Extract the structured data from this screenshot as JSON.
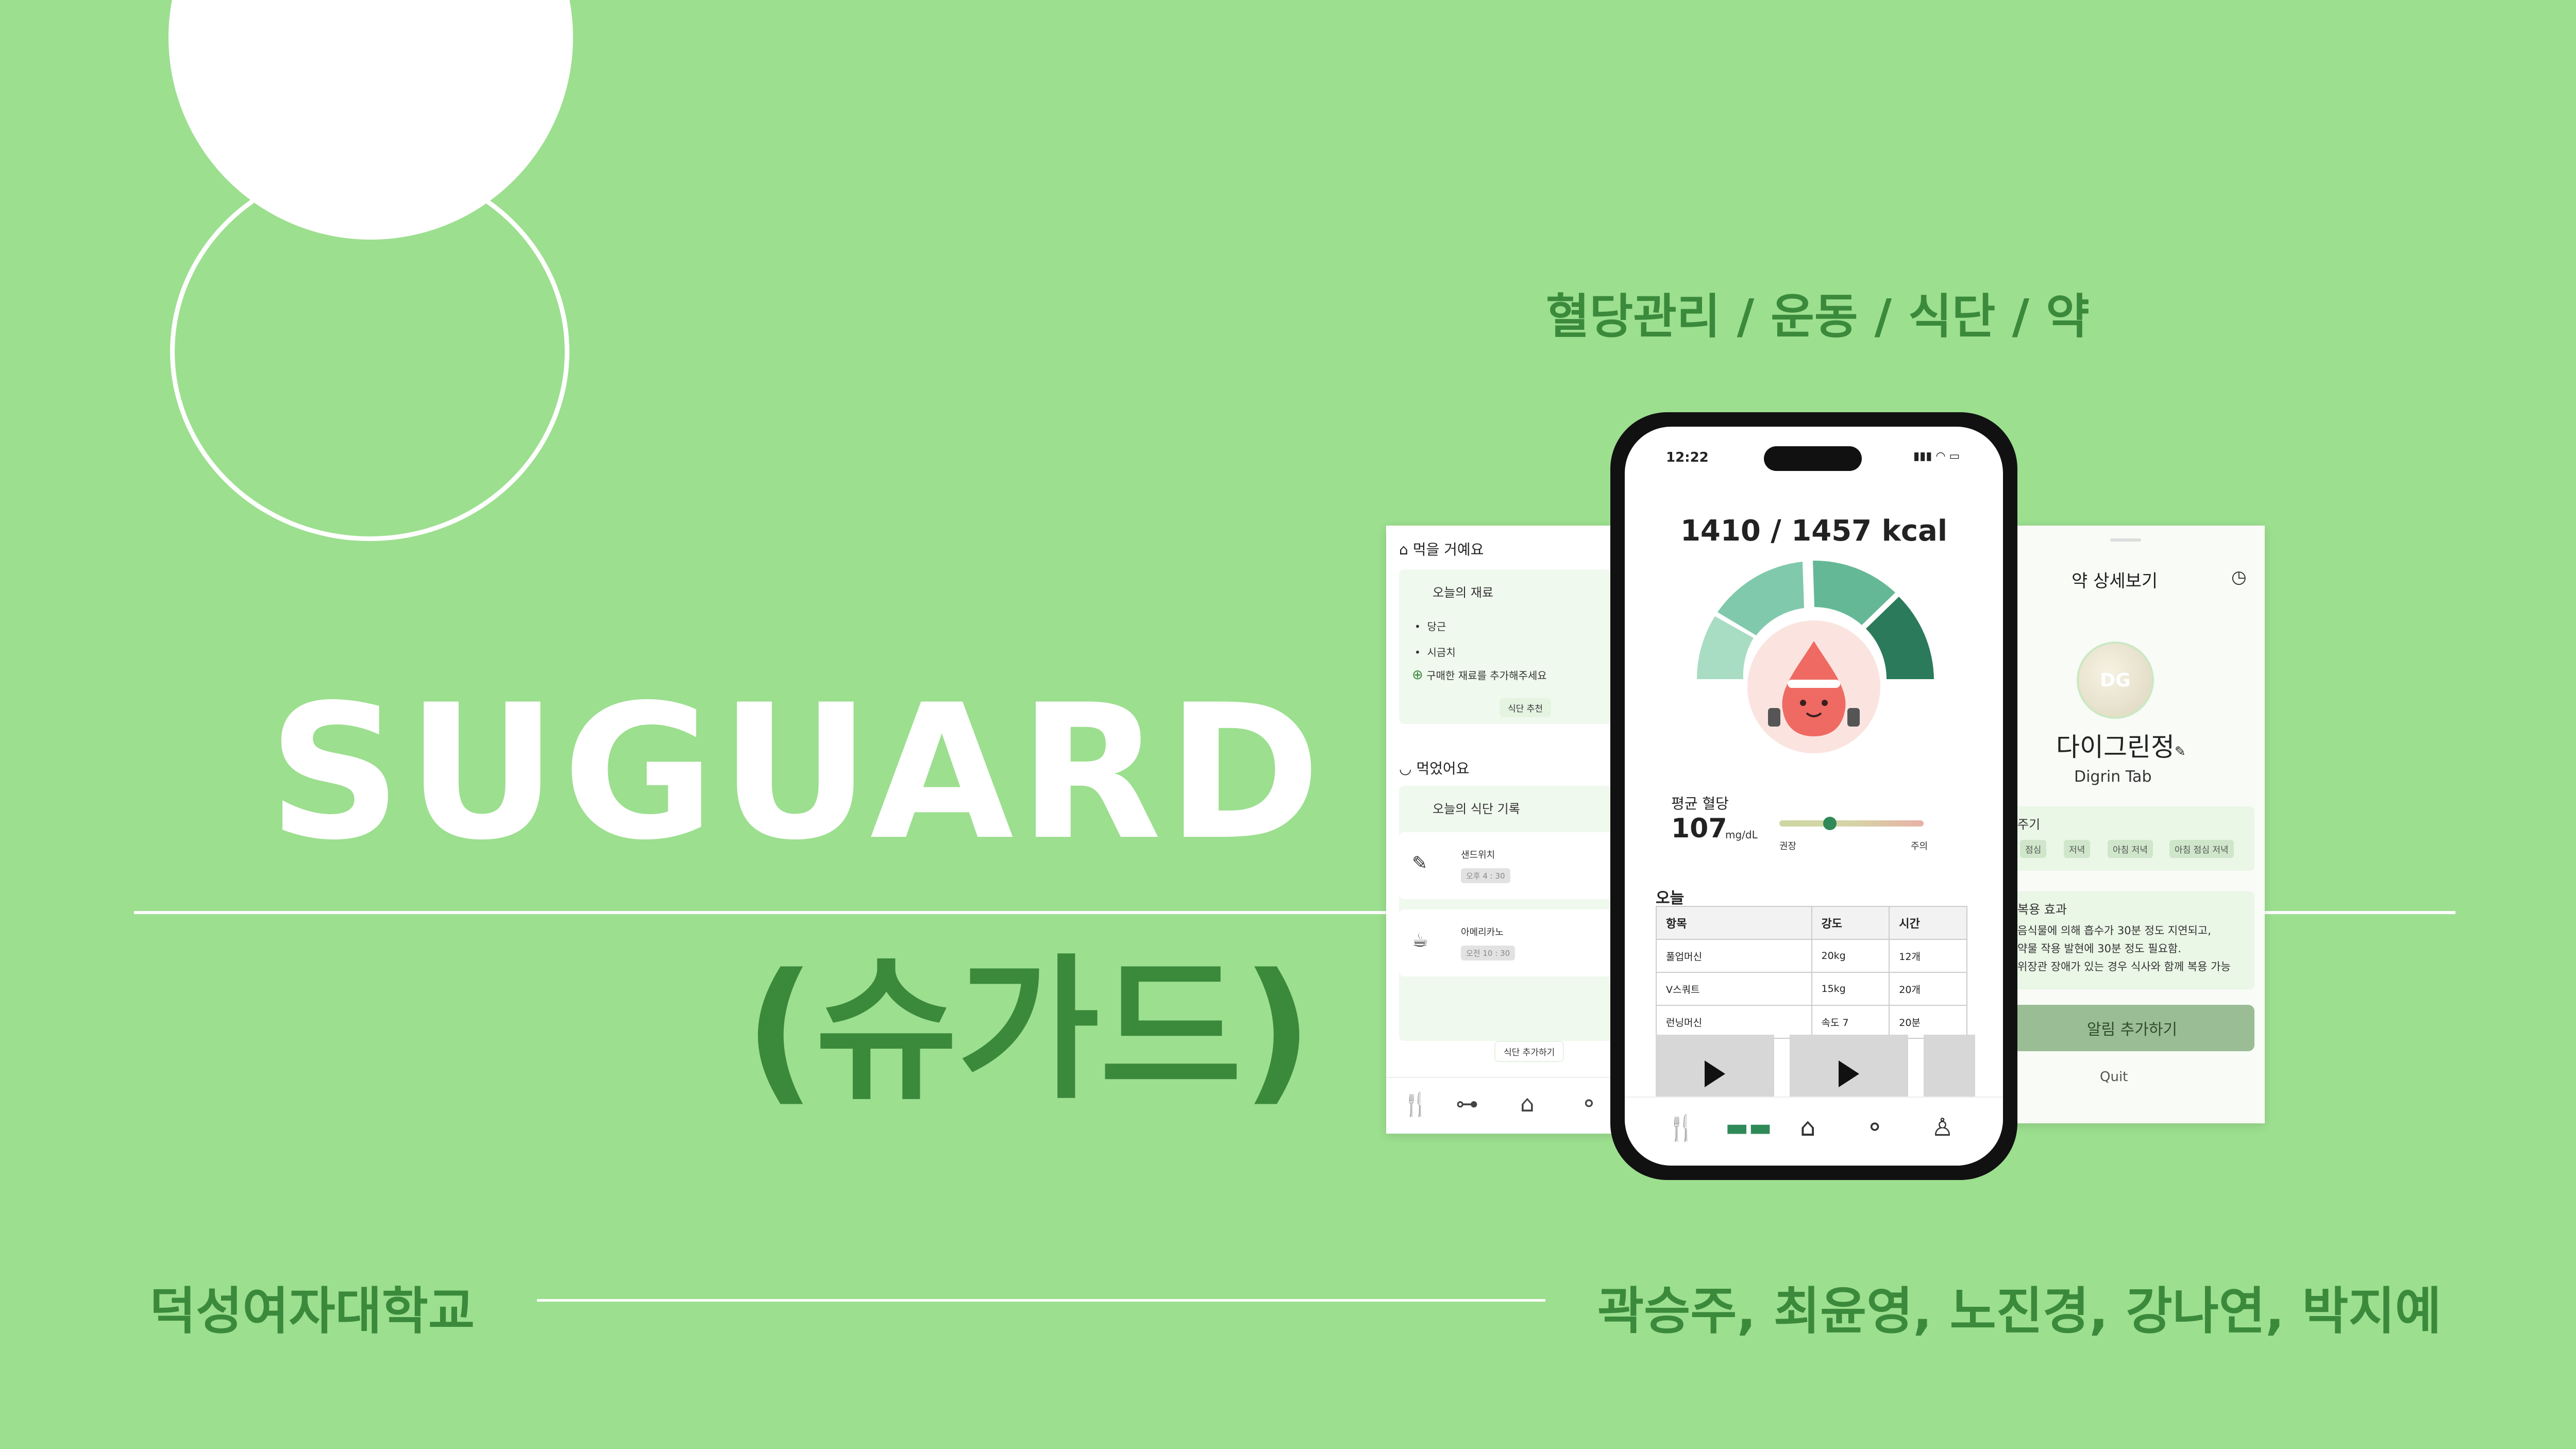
{
  "title": "SUGUARD",
  "subtitle": "(슈가드)",
  "tagline": "혈당관리 / 운동 / 식단 / 약",
  "university": "덕성여자대학교",
  "members": "곽승주, 최윤영, 노진경, 강나연, 박지예",
  "colors": {
    "background": "#9cdf8f",
    "accent": "#3b8a3c",
    "gauge_dark": "#2b7a5c",
    "gauge_mid": "#65b896",
    "gauge_light": "#a8dcc3"
  },
  "left_screen": {
    "section1": "먹을 거예요",
    "ingredients_title": "오늘의 재료",
    "ingredients": [
      "당근",
      "시금치"
    ],
    "add_ingredient": "구매한 재료를 추가해주세요",
    "recommend_button": "식단 추천",
    "section2": "먹었어요",
    "log_title": "오늘의 식단 기록",
    "meals": [
      {
        "name": "샌드위치",
        "time": "오후 4 : 30",
        "icon": "note-icon"
      },
      {
        "name": "아메리카노",
        "time": "오전 10 : 30",
        "icon": "coffee-icon"
      }
    ],
    "add_meal_button": "식단 추가하기",
    "nav": [
      "fork-knife-icon",
      "dumbbell-icon",
      "home-icon",
      "pill-icon"
    ]
  },
  "phone": {
    "time": "12:22",
    "kcal": "1410 / 1457 kcal",
    "avg_label": "평균 혈당",
    "avg_value": "107",
    "avg_unit": "mg/dL",
    "range_low": "권장",
    "range_high": "주의",
    "blood_sugar_position": 0.35,
    "today_label": "오늘",
    "table": {
      "headers": [
        "항목",
        "강도",
        "시간"
      ],
      "rows": [
        [
          "풀업머신",
          "20kg",
          "12개"
        ],
        [
          "V스쿼트",
          "15kg",
          "20개"
        ],
        [
          "런닝머신",
          "속도 7",
          "20분"
        ]
      ]
    },
    "nav": [
      "fork-knife-icon",
      "dumbbell-icon",
      "home-icon",
      "pill-icon",
      "person-icon"
    ]
  },
  "right_screen": {
    "title": "약 상세보기",
    "pill_mark": "DG",
    "name": "다이그린정",
    "english_name": "Digrin Tab",
    "cycle_label": "주기",
    "cycle_chips": [
      "점심",
      "저녁",
      "아침 저녁",
      "아침 점심 저녁"
    ],
    "effect_label": "복용 효과",
    "effect_lines": [
      "음식물에 의해 흡수가 30분 정도 지연되고,",
      "약물 작용 발현에 30분 정도 필요함.",
      "위장관 장애가 있는 경우 식사와 함께 복용 가능"
    ],
    "alarm_button": "알림 추가하기",
    "quit": "Quit"
  }
}
